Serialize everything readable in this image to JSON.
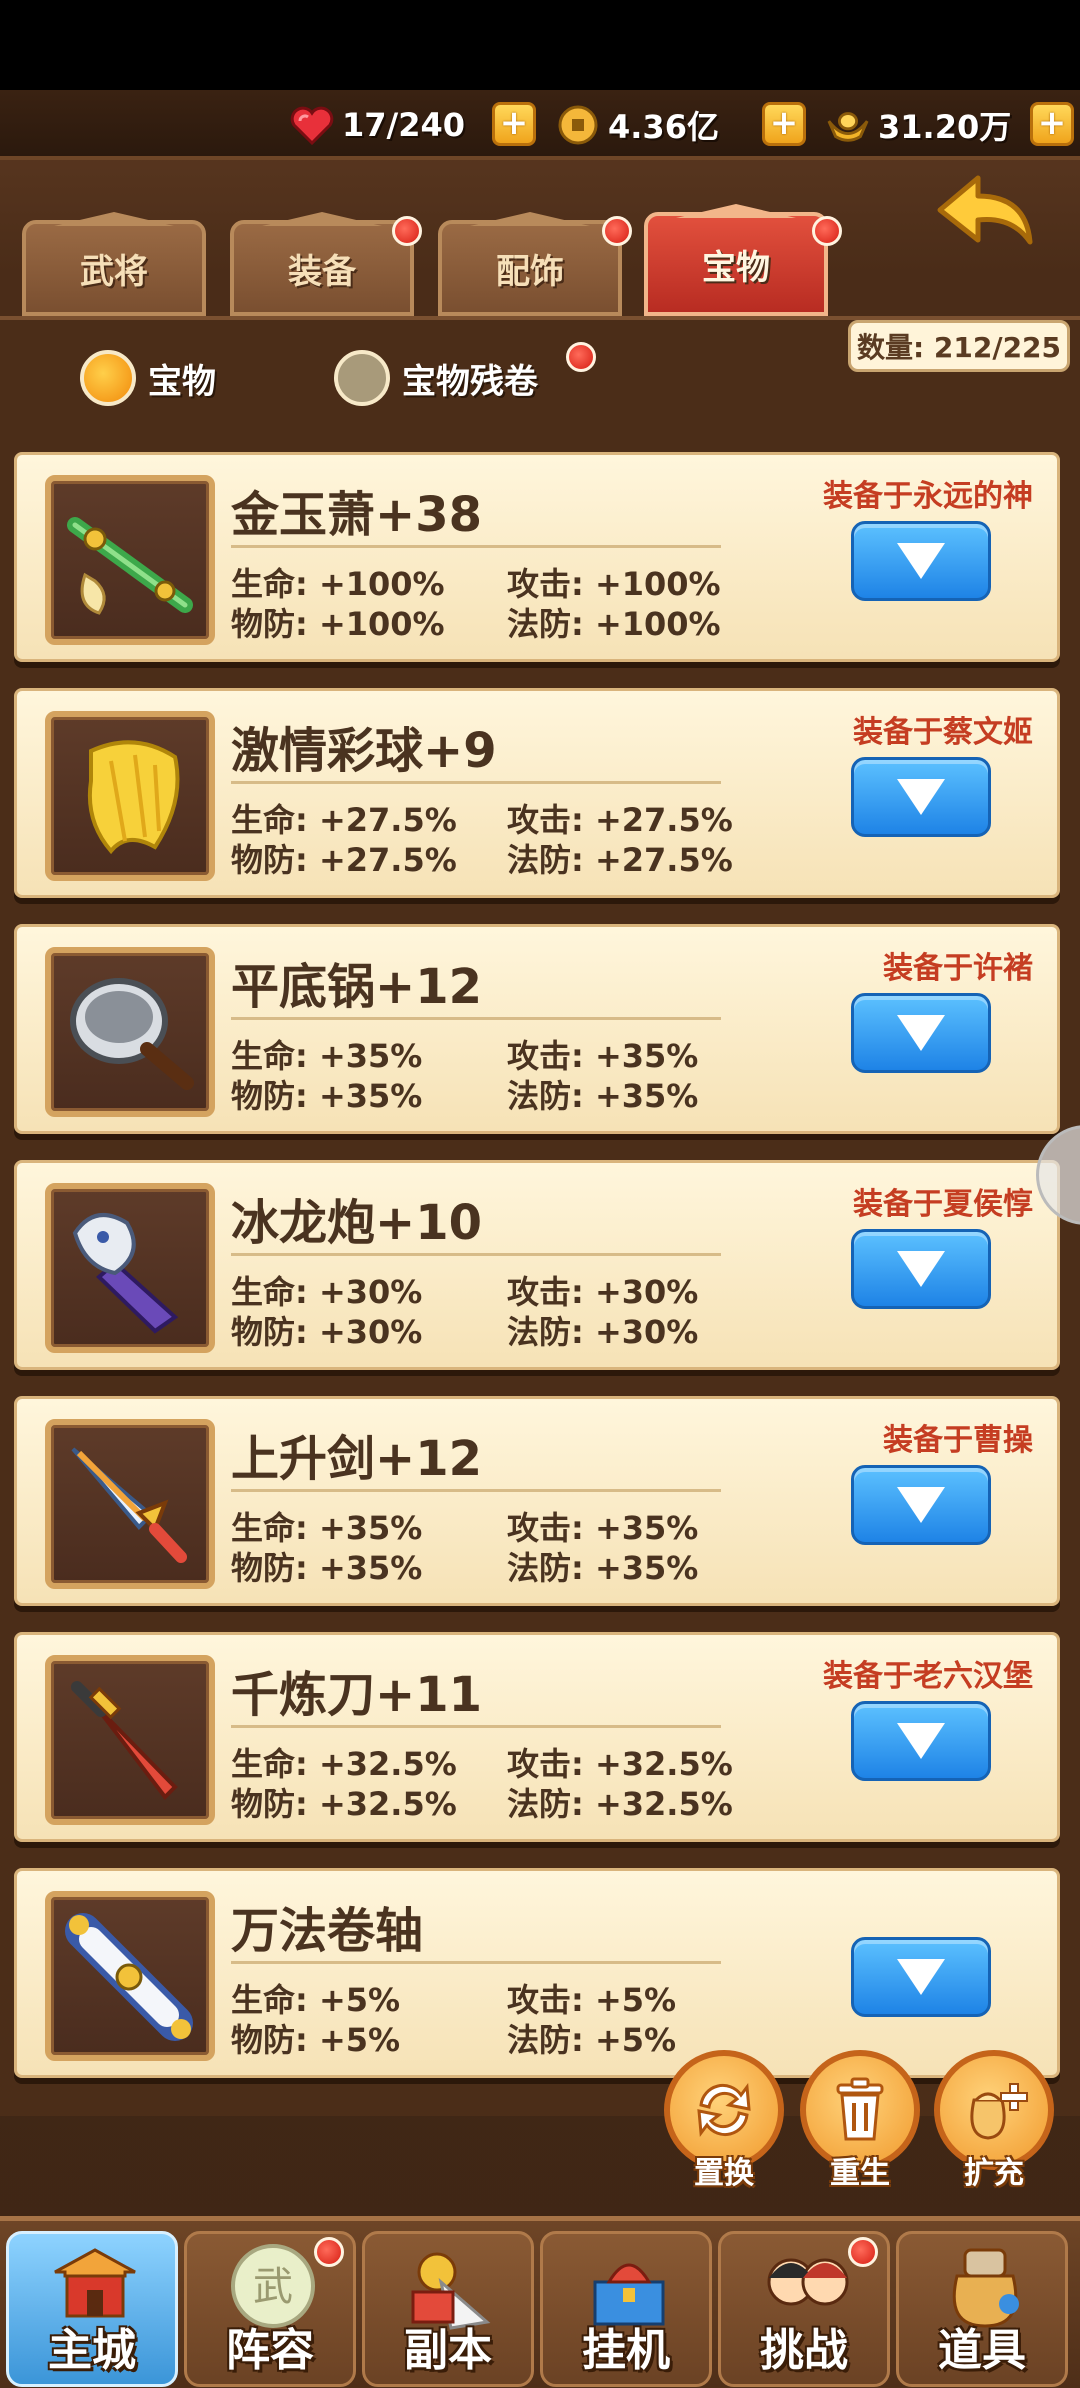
{
  "resources": {
    "stamina": "17/240",
    "coins": "4.36亿",
    "ingots": "31.20万",
    "plus": "+"
  },
  "tabs": [
    {
      "label": "武将",
      "active": false,
      "dot": false
    },
    {
      "label": "装备",
      "active": false,
      "dot": true
    },
    {
      "label": "配饰",
      "active": false,
      "dot": true
    },
    {
      "label": "宝物",
      "active": true,
      "dot": true
    }
  ],
  "filters": {
    "treasure": "宝物",
    "fragments": "宝物残卷",
    "count": "数量: 212/225"
  },
  "items": [
    {
      "name": "金玉萧+38",
      "equipped": "装备于永远的神",
      "hp": "生命: +100%",
      "atk": "攻击: +100%",
      "pdef": "物防: +100%",
      "mdef": "法防: +100%"
    },
    {
      "name": "激情彩球+9",
      "equipped": "装备于蔡文姬",
      "hp": "生命: +27.5%",
      "atk": "攻击: +27.5%",
      "pdef": "物防: +27.5%",
      "mdef": "法防: +27.5%"
    },
    {
      "name": "平底锅+12",
      "equipped": "装备于许褚",
      "hp": "生命: +35%",
      "atk": "攻击: +35%",
      "pdef": "物防: +35%",
      "mdef": "法防: +35%"
    },
    {
      "name": "冰龙炮+10",
      "equipped": "装备于夏侯惇",
      "hp": "生命: +30%",
      "atk": "攻击: +30%",
      "pdef": "物防: +30%",
      "mdef": "法防: +30%"
    },
    {
      "name": "上升剑+12",
      "equipped": "装备于曹操",
      "hp": "生命: +35%",
      "atk": "攻击: +35%",
      "pdef": "物防: +35%",
      "mdef": "法防: +35%"
    },
    {
      "name": "千炼刀+11",
      "equipped": "装备于老六汉堡",
      "hp": "生命: +32.5%",
      "atk": "攻击: +32.5%",
      "pdef": "物防: +32.5%",
      "mdef": "法防: +32.5%"
    },
    {
      "name": "万法卷轴",
      "equipped": "",
      "hp": "生命: +5%",
      "atk": "攻击: +5%",
      "pdef": "物防: +5%",
      "mdef": "法防: +5%"
    }
  ],
  "actions": {
    "swap": "置换",
    "rebirth": "重生",
    "expand": "扩充"
  },
  "nav": [
    {
      "label": "主城"
    },
    {
      "label": "阵容"
    },
    {
      "label": "副本"
    },
    {
      "label": "挂机"
    },
    {
      "label": "挑战"
    },
    {
      "label": "道具"
    }
  ]
}
